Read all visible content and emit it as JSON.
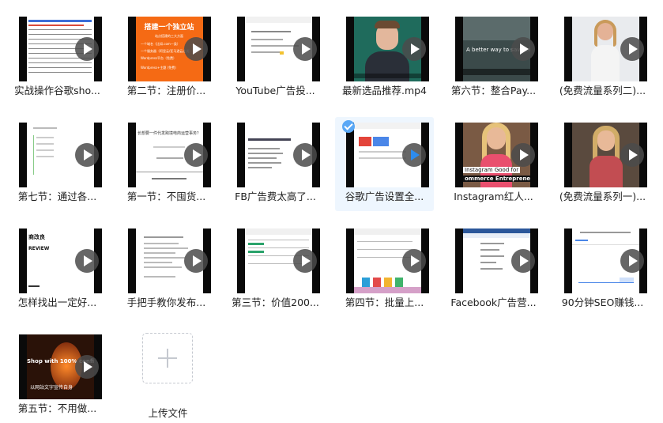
{
  "files": [
    {
      "name": "实战操作谷歌sho..."
    },
    {
      "name": "第二节：注册价..."
    },
    {
      "name": "YouTube广告投..."
    },
    {
      "name": "最新选品推荐.mp4"
    },
    {
      "name": "第六节：整合Pay..."
    },
    {
      "name": "(免费流量系列二)..."
    },
    {
      "name": "第七节：通过各..."
    },
    {
      "name": "第一节：不囤货..."
    },
    {
      "name": "FB广告费太高了..."
    },
    {
      "name": "谷歌广告设置全..."
    },
    {
      "name": "Instagram红人..."
    },
    {
      "name": "(免费流量系列一)..."
    },
    {
      "name": "怎样找出一定好..."
    },
    {
      "name": "手把手教你发布..."
    },
    {
      "name": "第三节：价值200..."
    },
    {
      "name": "第四节：批量上..."
    },
    {
      "name": "Facebook广告营..."
    },
    {
      "name": "90分钟SEO赚钱..."
    },
    {
      "name": "第五节：不用做..."
    }
  ],
  "thumb_text": {
    "t2_title": "搭建一个独立站",
    "t2_line1": "站点搭建的三大方面",
    "t2_line2": "一个域名（比如.com一类）",
    "t2_line3": "一个服务器（阿里云/亚马逊云之类）",
    "t2_line4": "Wordpress平台（免费）",
    "t2_line5": "Wordpress+主题 (免费)",
    "t5_overlay": "A better way to save big",
    "t8_title": "长想要一件代发跨境电商运营事务？",
    "t11_line1": "Instagram Good for",
    "t11_line2": "ommerce Entreprene",
    "t13_l1": "商改良",
    "t13_l2": "REVIEW",
    "t19_l1": "Shop with 100% confidence",
    "t19_l2": "以网站文字宣传自身"
  },
  "upload": {
    "label": "上传文件"
  },
  "selected_index": 9
}
